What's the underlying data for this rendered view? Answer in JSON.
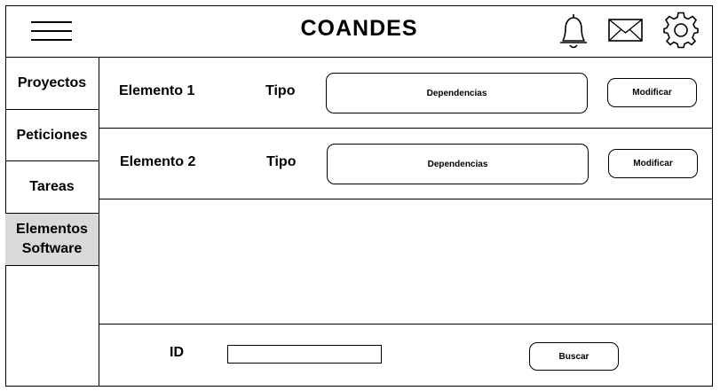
{
  "header": {
    "title": "COANDES",
    "icons": [
      "menu-icon",
      "bell-icon",
      "mail-icon",
      "gear-icon"
    ]
  },
  "sidebar": {
    "items": [
      {
        "label": "Proyectos"
      },
      {
        "label": "Peticiones"
      },
      {
        "label": "Tareas"
      },
      {
        "label": "Elementos Software",
        "active": true
      }
    ]
  },
  "elements": [
    {
      "name": "Elemento 1",
      "type_label": "Tipo",
      "dependencies_label": "Dependencias",
      "modify_label": "Modificar"
    },
    {
      "name": "Elemento 2",
      "type_label": "Tipo",
      "dependencies_label": "Dependencias",
      "modify_label": "Modificar"
    }
  ],
  "search": {
    "id_label": "ID",
    "value": "",
    "button_label": "Buscar"
  },
  "colors": {
    "active_sidebar_bg": "#d9d9d9",
    "border": "#000000"
  }
}
